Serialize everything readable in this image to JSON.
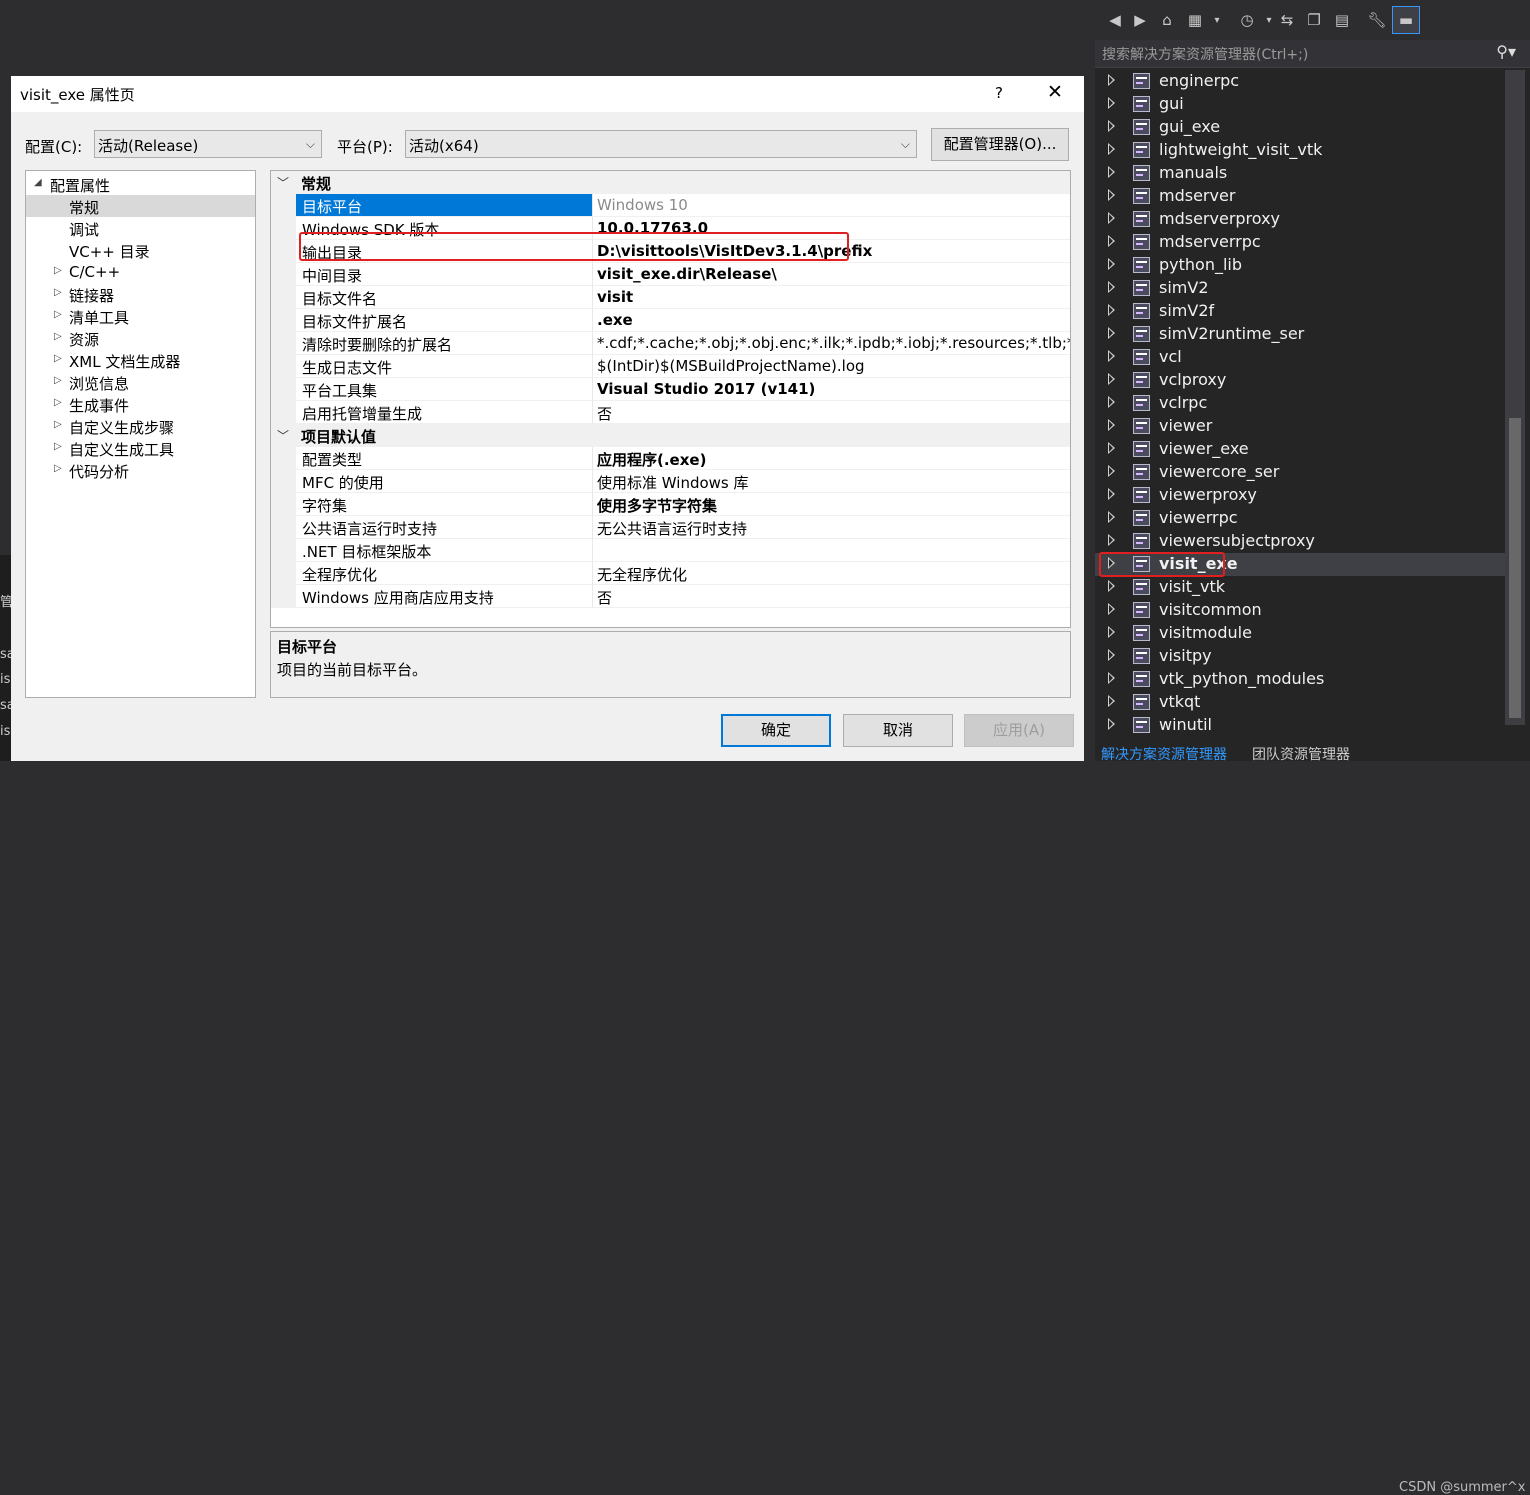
{
  "dialog": {
    "title": "visit_exe 属性页",
    "help": "?",
    "close": "✕",
    "config_label": "配置(C):",
    "config_value": "活动(Release)",
    "platform_label": "平台(P):",
    "platform_value": "活动(x64)",
    "config_manager": "配置管理器(O)...",
    "ok": "确定",
    "cancel": "取消",
    "apply": "应用(A)"
  },
  "tree": {
    "root": "配置属性",
    "items": [
      "常规",
      "调试",
      "VC++ 目录",
      "C/C++",
      "链接器",
      "清单工具",
      "资源",
      "XML 文档生成器",
      "浏览信息",
      "生成事件",
      "自定义生成步骤",
      "自定义生成工具",
      "代码分析"
    ]
  },
  "grid": {
    "cat1": "常规",
    "cat2": "项目默认值",
    "rows1": [
      {
        "name": "目标平台",
        "value": "Windows 10"
      },
      {
        "name": "Windows SDK 版本",
        "value": "10.0.17763.0"
      },
      {
        "name": "输出目录",
        "value": "D:\\visittools\\VisItDev3.1.4\\prefix"
      },
      {
        "name": "中间目录",
        "value": "visit_exe.dir\\Release\\"
      },
      {
        "name": "目标文件名",
        "value": "visit"
      },
      {
        "name": "目标文件扩展名",
        "value": ".exe"
      },
      {
        "name": "清除时要删除的扩展名",
        "value": "*.cdf;*.cache;*.obj;*.obj.enc;*.ilk;*.ipdb;*.iobj;*.resources;*.tlb;*.tli;"
      },
      {
        "name": "生成日志文件",
        "value": "$(IntDir)$(MSBuildProjectName).log"
      },
      {
        "name": "平台工具集",
        "value": "Visual Studio 2017 (v141)"
      },
      {
        "name": "启用托管增量生成",
        "value": "否"
      }
    ],
    "rows2": [
      {
        "name": "配置类型",
        "value": "应用程序(.exe)"
      },
      {
        "name": "MFC 的使用",
        "value": "使用标准 Windows 库"
      },
      {
        "name": "字符集",
        "value": "使用多字节字符集"
      },
      {
        "name": "公共语言运行时支持",
        "value": "无公共语言运行时支持"
      },
      {
        "name": ".NET 目标框架版本",
        "value": ""
      },
      {
        "name": "全程序优化",
        "value": "无全程序优化"
      },
      {
        "name": "Windows 应用商店应用支持",
        "value": "否"
      }
    ]
  },
  "description": {
    "title": "目标平台",
    "text": "项目的当前目标平台。"
  },
  "solution_explorer": {
    "search_placeholder": "搜索解决方案资源管理器(Ctrl+;)",
    "projects": [
      "enginerpc",
      "gui",
      "gui_exe",
      "lightweight_visit_vtk",
      "manuals",
      "mdserver",
      "mdserverproxy",
      "mdserverrpc",
      "python_lib",
      "simV2",
      "simV2f",
      "simV2runtime_ser",
      "vcl",
      "vclproxy",
      "vclrpc",
      "viewer",
      "viewer_exe",
      "viewercore_ser",
      "viewerproxy",
      "viewerrpc",
      "viewersubjectproxy",
      "visit_exe",
      "visit_vtk",
      "visitcommon",
      "visitmodule",
      "visitpy",
      "vtk_python_modules",
      "vtkqt",
      "winutil"
    ],
    "selected": "visit_exe",
    "tab_solution": "解决方案资源管理器",
    "tab_team": "团队资源管理器",
    "watermark": "CSDN @summer^x"
  },
  "background_fragments": [
    "管",
    "sa",
    "is",
    "sa",
    "is"
  ],
  "colors": {
    "accent": "#0078d7",
    "highlight": "#e02020",
    "dark_bg": "#252526"
  }
}
